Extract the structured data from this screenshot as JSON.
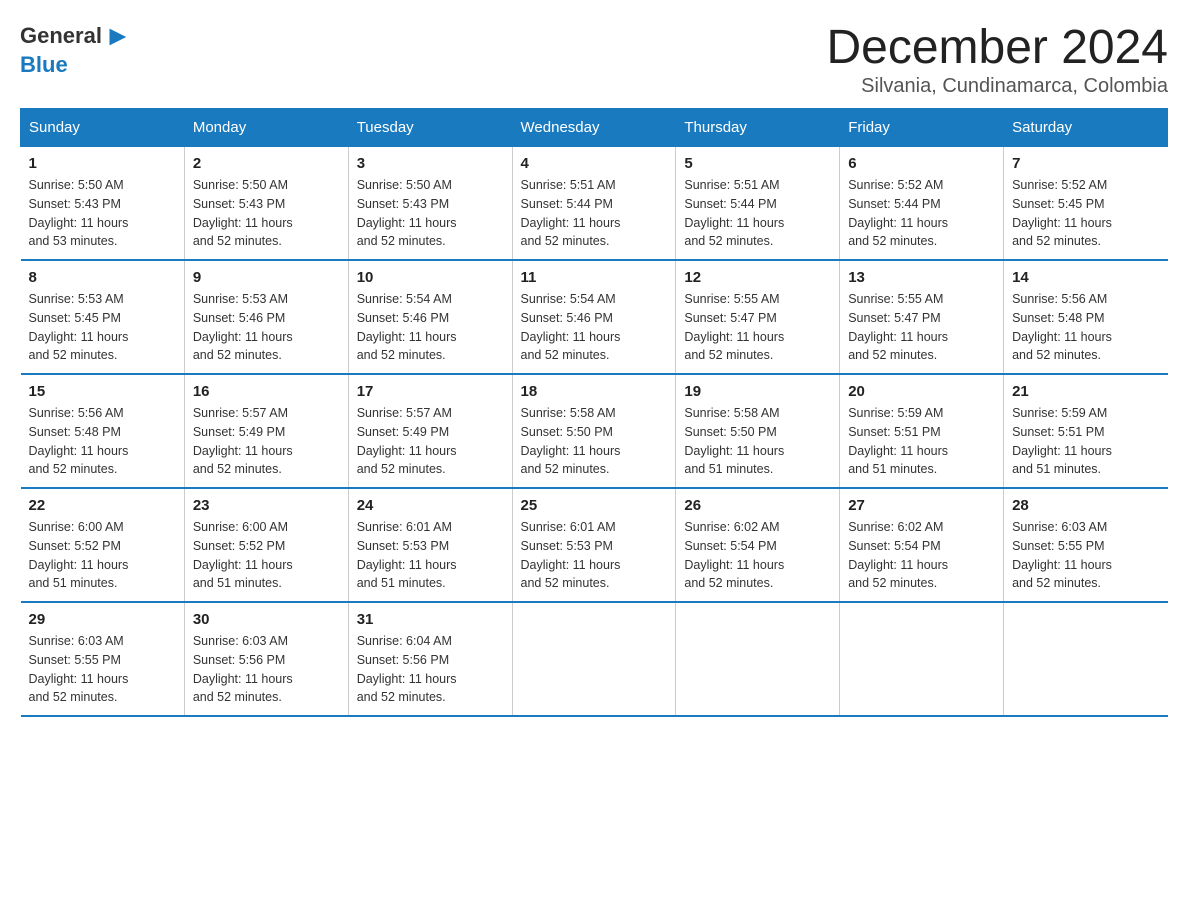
{
  "header": {
    "logo": {
      "general": "General",
      "blue": "Blue"
    },
    "title": "December 2024",
    "subtitle": "Silvania, Cundinamarca, Colombia"
  },
  "days_of_week": [
    "Sunday",
    "Monday",
    "Tuesday",
    "Wednesday",
    "Thursday",
    "Friday",
    "Saturday"
  ],
  "weeks": [
    [
      {
        "day": "1",
        "sunrise": "5:50 AM",
        "sunset": "5:43 PM",
        "daylight": "11 hours and 53 minutes."
      },
      {
        "day": "2",
        "sunrise": "5:50 AM",
        "sunset": "5:43 PM",
        "daylight": "11 hours and 52 minutes."
      },
      {
        "day": "3",
        "sunrise": "5:50 AM",
        "sunset": "5:43 PM",
        "daylight": "11 hours and 52 minutes."
      },
      {
        "day": "4",
        "sunrise": "5:51 AM",
        "sunset": "5:44 PM",
        "daylight": "11 hours and 52 minutes."
      },
      {
        "day": "5",
        "sunrise": "5:51 AM",
        "sunset": "5:44 PM",
        "daylight": "11 hours and 52 minutes."
      },
      {
        "day": "6",
        "sunrise": "5:52 AM",
        "sunset": "5:44 PM",
        "daylight": "11 hours and 52 minutes."
      },
      {
        "day": "7",
        "sunrise": "5:52 AM",
        "sunset": "5:45 PM",
        "daylight": "11 hours and 52 minutes."
      }
    ],
    [
      {
        "day": "8",
        "sunrise": "5:53 AM",
        "sunset": "5:45 PM",
        "daylight": "11 hours and 52 minutes."
      },
      {
        "day": "9",
        "sunrise": "5:53 AM",
        "sunset": "5:46 PM",
        "daylight": "11 hours and 52 minutes."
      },
      {
        "day": "10",
        "sunrise": "5:54 AM",
        "sunset": "5:46 PM",
        "daylight": "11 hours and 52 minutes."
      },
      {
        "day": "11",
        "sunrise": "5:54 AM",
        "sunset": "5:46 PM",
        "daylight": "11 hours and 52 minutes."
      },
      {
        "day": "12",
        "sunrise": "5:55 AM",
        "sunset": "5:47 PM",
        "daylight": "11 hours and 52 minutes."
      },
      {
        "day": "13",
        "sunrise": "5:55 AM",
        "sunset": "5:47 PM",
        "daylight": "11 hours and 52 minutes."
      },
      {
        "day": "14",
        "sunrise": "5:56 AM",
        "sunset": "5:48 PM",
        "daylight": "11 hours and 52 minutes."
      }
    ],
    [
      {
        "day": "15",
        "sunrise": "5:56 AM",
        "sunset": "5:48 PM",
        "daylight": "11 hours and 52 minutes."
      },
      {
        "day": "16",
        "sunrise": "5:57 AM",
        "sunset": "5:49 PM",
        "daylight": "11 hours and 52 minutes."
      },
      {
        "day": "17",
        "sunrise": "5:57 AM",
        "sunset": "5:49 PM",
        "daylight": "11 hours and 52 minutes."
      },
      {
        "day": "18",
        "sunrise": "5:58 AM",
        "sunset": "5:50 PM",
        "daylight": "11 hours and 52 minutes."
      },
      {
        "day": "19",
        "sunrise": "5:58 AM",
        "sunset": "5:50 PM",
        "daylight": "11 hours and 51 minutes."
      },
      {
        "day": "20",
        "sunrise": "5:59 AM",
        "sunset": "5:51 PM",
        "daylight": "11 hours and 51 minutes."
      },
      {
        "day": "21",
        "sunrise": "5:59 AM",
        "sunset": "5:51 PM",
        "daylight": "11 hours and 51 minutes."
      }
    ],
    [
      {
        "day": "22",
        "sunrise": "6:00 AM",
        "sunset": "5:52 PM",
        "daylight": "11 hours and 51 minutes."
      },
      {
        "day": "23",
        "sunrise": "6:00 AM",
        "sunset": "5:52 PM",
        "daylight": "11 hours and 51 minutes."
      },
      {
        "day": "24",
        "sunrise": "6:01 AM",
        "sunset": "5:53 PM",
        "daylight": "11 hours and 51 minutes."
      },
      {
        "day": "25",
        "sunrise": "6:01 AM",
        "sunset": "5:53 PM",
        "daylight": "11 hours and 52 minutes."
      },
      {
        "day": "26",
        "sunrise": "6:02 AM",
        "sunset": "5:54 PM",
        "daylight": "11 hours and 52 minutes."
      },
      {
        "day": "27",
        "sunrise": "6:02 AM",
        "sunset": "5:54 PM",
        "daylight": "11 hours and 52 minutes."
      },
      {
        "day": "28",
        "sunrise": "6:03 AM",
        "sunset": "5:55 PM",
        "daylight": "11 hours and 52 minutes."
      }
    ],
    [
      {
        "day": "29",
        "sunrise": "6:03 AM",
        "sunset": "5:55 PM",
        "daylight": "11 hours and 52 minutes."
      },
      {
        "day": "30",
        "sunrise": "6:03 AM",
        "sunset": "5:56 PM",
        "daylight": "11 hours and 52 minutes."
      },
      {
        "day": "31",
        "sunrise": "6:04 AM",
        "sunset": "5:56 PM",
        "daylight": "11 hours and 52 minutes."
      },
      null,
      null,
      null,
      null
    ]
  ],
  "labels": {
    "sunrise": "Sunrise:",
    "sunset": "Sunset:",
    "daylight": "Daylight:"
  }
}
